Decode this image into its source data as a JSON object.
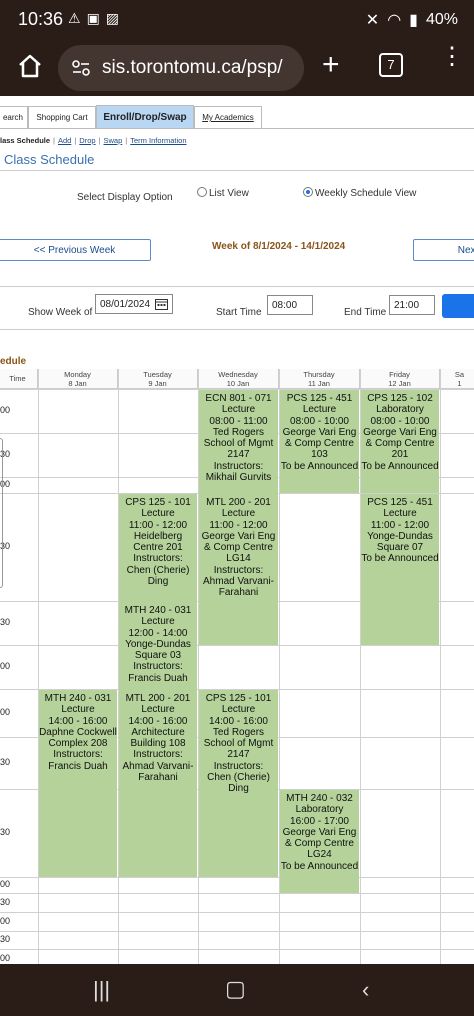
{
  "status": {
    "time": "10:36",
    "battery": "40%"
  },
  "browser": {
    "url": "sis.torontomu.ca/psp/",
    "tab_count": "7"
  },
  "tabs": [
    {
      "label": "earch"
    },
    {
      "label": "Shopping Cart"
    },
    {
      "label": "Enroll/Drop/Swap"
    },
    {
      "label": "My Academics"
    }
  ],
  "sublinks": {
    "current": "lass Schedule",
    "items": [
      "Add",
      "Drop",
      "Swap",
      "Term Information"
    ]
  },
  "page_title": "Class Schedule",
  "display": {
    "label": "Select Display Option",
    "list_view": "List View",
    "weekly_view": "Weekly Schedule View",
    "selected": "weekly"
  },
  "nav": {
    "prev": "<< Previous Week",
    "week_range": "Week of 8/1/2024 - 14/1/2024",
    "next": "Next"
  },
  "filters": {
    "show_week_label": "Show Week of",
    "show_week_value": "08/01/2024",
    "start_time_label": "Start Time",
    "start_time_value": "08:00",
    "end_time_label": "End Time",
    "end_time_value": "21:00"
  },
  "schedule_label": "edule",
  "grid": {
    "time_header": "Time",
    "days": [
      {
        "name": "Monday",
        "date": "8 Jan"
      },
      {
        "name": "Tuesday",
        "date": "9 Jan"
      },
      {
        "name": "Wednesday",
        "date": "10 Jan"
      },
      {
        "name": "Thursday",
        "date": "11 Jan"
      },
      {
        "name": "Friday",
        "date": "12 Jan"
      },
      {
        "name": "Sa",
        "date": "1"
      }
    ],
    "time_labels": [
      "00",
      "30",
      "00",
      "30",
      "30",
      "00",
      "00",
      "30",
      "30",
      "00",
      "30",
      "00",
      "30",
      "00",
      "30"
    ]
  },
  "events": [
    {
      "day": 2,
      "lines": [
        "ECN 801 - 071",
        "Lecture",
        "08:00 - 11:00",
        "Ted Rogers",
        "School of Mgmt",
        "2147",
        "Instructors:",
        "Mikhail Gurvits"
      ]
    },
    {
      "day": 3,
      "lines": [
        "PCS 125 - 451",
        "Lecture",
        "08:00 - 10:00",
        "George Vari Eng",
        "& Comp Centre",
        "103",
        "To be Announced"
      ]
    },
    {
      "day": 4,
      "lines": [
        "CPS 125 - 102",
        "Laboratory",
        "08:00 - 10:00",
        "George Vari Eng",
        "& Comp Centre",
        "201",
        "To be Announced"
      ]
    },
    {
      "day": 1,
      "lines": [
        "CPS 125 - 101",
        "Lecture",
        "11:00 - 12:00",
        "Heidelberg",
        "Centre 201",
        "Instructors:",
        "Chen (Cherie)",
        "Ding"
      ]
    },
    {
      "day": 2,
      "lines": [
        "MTL 200 - 201",
        "Lecture",
        "11:00 - 12:00",
        "George Vari Eng",
        "& Comp Centre",
        "LG14",
        "Instructors:",
        "Ahmad Varvani-",
        "Farahani"
      ]
    },
    {
      "day": 4,
      "lines": [
        "PCS 125 - 451",
        "Lecture",
        "11:00 - 12:00",
        "Yonge-Dundas",
        "Square 07",
        "To be Announced"
      ]
    },
    {
      "day": 1,
      "lines": [
        "MTH 240 - 031",
        "Lecture",
        "12:00 - 14:00",
        "Yonge-Dundas",
        "Square 03",
        "Instructors:",
        "Francis Duah"
      ]
    },
    {
      "day": 0,
      "lines": [
        "MTH 240 - 031",
        "Lecture",
        "14:00 - 16:00",
        "Daphne Cockwell",
        "Complex 208",
        "Instructors:",
        "Francis Duah"
      ]
    },
    {
      "day": 1,
      "lines": [
        "MTL 200 - 201",
        "Lecture",
        "14:00 - 16:00",
        "Architecture",
        "Building 108",
        "Instructors:",
        "Ahmad Varvani-",
        "Farahani"
      ]
    },
    {
      "day": 2,
      "lines": [
        "CPS 125 - 101",
        "Lecture",
        "14:00 - 16:00",
        "Ted Rogers",
        "School of Mgmt",
        "2147",
        "Instructors:",
        "Chen (Cherie)",
        "Ding"
      ]
    },
    {
      "day": 3,
      "lines": [
        "MTH 240 - 032",
        "Laboratory",
        "16:00 - 17:00",
        "George Vari Eng",
        "& Comp Centre",
        "LG24",
        "To be Announced"
      ]
    }
  ],
  "colors": {
    "event_bg": "#b4d29a",
    "accent_blue": "#1a73e8",
    "week_range": "#8a5418",
    "system_bar": "#2a1d18"
  }
}
